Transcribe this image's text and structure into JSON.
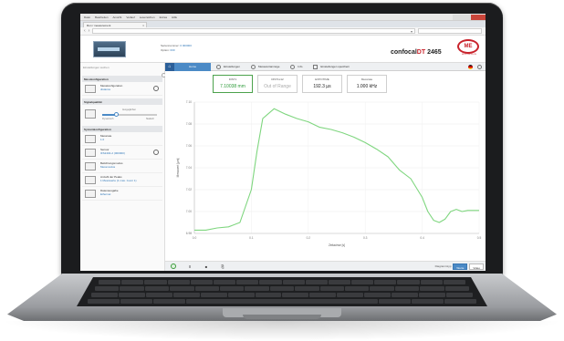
{
  "menu": [
    "Datei",
    "Bearbeiten",
    "Ansicht",
    "Verlauf",
    "Lesezeichen",
    "Extras",
    "Hilfe"
  ],
  "browser": {
    "tab_title": "Run / measurement",
    "url": ""
  },
  "header": {
    "serial_label": "Seriennummer:",
    "serial_value": "0 000000",
    "option_label": "Option:",
    "option_value": "000",
    "brand_prefix": "confocal",
    "brand_accent": "DT",
    "brand_model": "2465",
    "logo_text": "ME",
    "logo_sub": "MICRO-EPSILON"
  },
  "nav": {
    "search_placeholder": "Einstellungen suchen",
    "items": [
      "Home",
      "Einstellungen",
      "Messwertanzeige",
      "Info"
    ],
    "save_label": "Einstellungen speichern"
  },
  "sidebar": {
    "sections": [
      {
        "title": "Messkonfiguration"
      },
      {
        "title": "Signalqualität"
      },
      {
        "title": "Systemkonfiguration"
      }
    ],
    "measurement": {
      "label": "Messkonfiguration",
      "value": "distance"
    },
    "signal": {
      "top": "Ausgeglichen",
      "lo": "Dynamisch",
      "hi": "Statisch",
      "level": 0.25
    },
    "system_items": [
      {
        "label": "Messrate",
        "value": "1.0"
      },
      {
        "label": "Sensor",
        "value": "IFS2404-2 (000000)"
      },
      {
        "label": "Belichtungsmodus",
        "value": "Messmodus"
      },
      {
        "label": "Anzahl der Peaks",
        "value": "1 Messwerte (1 max. zuvor 1)"
      },
      {
        "label": "Datenausgabe",
        "value": "Ethernet"
      }
    ]
  },
  "tiles": [
    {
      "label": "DIST1",
      "value": "7.10038 mm"
    },
    {
      "label": "DIST1x12",
      "value": "Out of Range"
    },
    {
      "label": "EXPOTIME",
      "value": "192.3 µs"
    },
    {
      "label": "Messrate",
      "value": "1.000 kHz"
    }
  ],
  "chart_data": {
    "type": "line",
    "ylabel": "Messwert [µm]",
    "xlabel": "Zeitachse [s]",
    "y_ticks": [
      "7.10",
      "7.08",
      "7.06",
      "7.04",
      "7.02",
      "7.00",
      "6.98"
    ],
    "x_ticks": [
      "0.0",
      "0.1",
      "0.2",
      "0.3",
      "0.4",
      "0.5"
    ],
    "ylim": [
      6.98,
      7.1
    ],
    "xlim": [
      0,
      0.5
    ],
    "series": [
      {
        "x": [
          0.0,
          0.02,
          0.04,
          0.06,
          0.08,
          0.1,
          0.11,
          0.12,
          0.14,
          0.16,
          0.18,
          0.2,
          0.22,
          0.24,
          0.26,
          0.28,
          0.3,
          0.32,
          0.34,
          0.36,
          0.38,
          0.4,
          0.41,
          0.42,
          0.43,
          0.44,
          0.45,
          0.46,
          0.47,
          0.48,
          0.49,
          0.5
        ],
        "y": [
          6.983,
          6.983,
          6.985,
          6.986,
          6.99,
          7.02,
          7.055,
          7.085,
          7.094,
          7.089,
          7.085,
          7.082,
          7.077,
          7.075,
          7.072,
          7.068,
          7.063,
          7.057,
          7.05,
          7.038,
          7.03,
          7.013,
          7.0,
          6.992,
          6.99,
          6.993,
          7.0,
          7.002,
          7.0,
          7.001,
          7.001,
          7.001
        ],
        "color": "#7fd67f"
      }
    ]
  },
  "bottom": {
    "display_label": "Diagrammtyp",
    "mode_on": "Werte",
    "mode_off": "Video"
  },
  "colors": {
    "accent": "#4b8ac6",
    "brand_red": "#c9232c",
    "ok_green": "#2e9b3a"
  }
}
